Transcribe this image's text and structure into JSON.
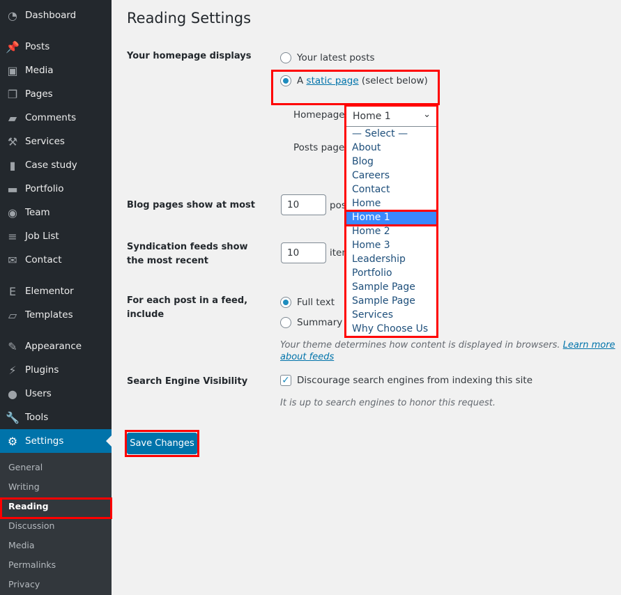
{
  "sidebar": {
    "items": [
      {
        "label": "Dashboard",
        "icon": "dashboard-icon"
      },
      {
        "label": "Posts",
        "icon": "pin-icon"
      },
      {
        "label": "Media",
        "icon": "media-icon"
      },
      {
        "label": "Pages",
        "icon": "pages-icon"
      },
      {
        "label": "Comments",
        "icon": "comment-icon"
      },
      {
        "label": "Services",
        "icon": "hammer-icon"
      },
      {
        "label": "Case study",
        "icon": "book-icon"
      },
      {
        "label": "Portfolio",
        "icon": "folder-icon"
      },
      {
        "label": "Team",
        "icon": "team-icon"
      },
      {
        "label": "Job List",
        "icon": "list-icon"
      },
      {
        "label": "Contact",
        "icon": "mail-icon"
      },
      {
        "label": "Elementor",
        "icon": "elementor-icon"
      },
      {
        "label": "Templates",
        "icon": "folder-open-icon"
      },
      {
        "label": "Appearance",
        "icon": "brush-icon"
      },
      {
        "label": "Plugins",
        "icon": "plug-icon"
      },
      {
        "label": "Users",
        "icon": "user-icon"
      },
      {
        "label": "Tools",
        "icon": "wrench-icon"
      },
      {
        "label": "Settings",
        "icon": "settings-icon"
      }
    ],
    "submenu": [
      "General",
      "Writing",
      "Reading",
      "Discussion",
      "Media",
      "Permalinks",
      "Privacy"
    ],
    "accent": "#0073aa"
  },
  "page": {
    "title": "Reading Settings",
    "homepage_displays": {
      "label": "Your homepage displays",
      "latest": "Your latest posts",
      "static_prefix": "A",
      "static_link": "static page",
      "static_suffix": "(select below)",
      "homepage_label": "Homepage:",
      "homepage_value": "Home 1",
      "posts_page_label": "Posts page:",
      "options": [
        "— Select —",
        "About",
        "Blog",
        "Careers",
        "Contact",
        "Home",
        "Home 1",
        "Home 2",
        "Home 3",
        "Leadership",
        "Portfolio",
        "Sample Page",
        "Sample Page",
        "Services",
        "Why Choose Us"
      ]
    },
    "blog_pages": {
      "label": "Blog pages show at most",
      "value": "10",
      "unit": "posts"
    },
    "syndication": {
      "label": "Syndication feeds show the most recent",
      "value": "10",
      "unit": "items"
    },
    "feed": {
      "label": "For each post in a feed, include",
      "full": "Full text",
      "summary": "Summary",
      "desc": "Your theme determines how content is displayed in browsers.",
      "link": "Learn more about feeds"
    },
    "search": {
      "label": "Search Engine Visibility",
      "checkbox": "Discourage search engines from indexing this site",
      "checked": true,
      "desc": "It is up to search engines to honor this request."
    },
    "save": "Save Changes"
  }
}
